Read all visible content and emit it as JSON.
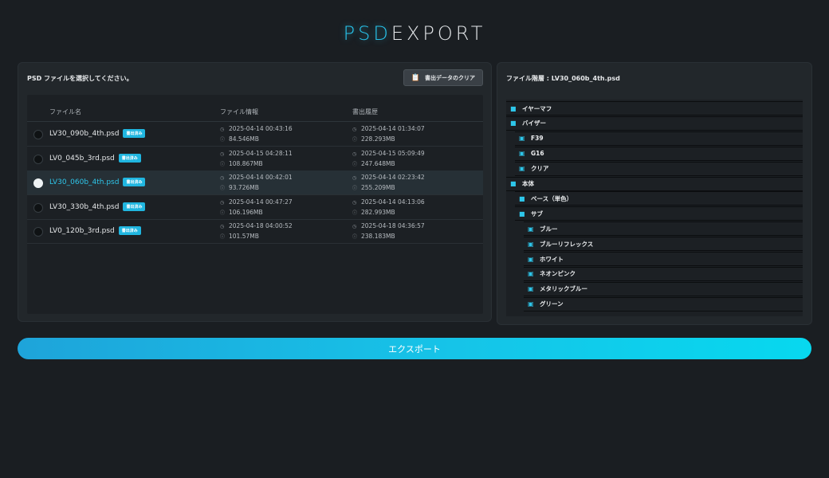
{
  "app": {
    "title_accent": "PSD",
    "title_rest": "EXPORT"
  },
  "left": {
    "prompt": "PSD ファイルを選択してください。",
    "clear_button": "書出データのクリア",
    "columns": [
      "ファイル名",
      "ファイル情報",
      "書出履歴"
    ],
    "files": [
      {
        "name": "LV30_090b_4th.psd",
        "badge": "書出済み",
        "modified": "2025-04-14 00:43:16",
        "size": "84.546MB",
        "export_time": "2025-04-14 01:34:07",
        "export_size": "228.293MB",
        "selected": false
      },
      {
        "name": "LV0_045b_3rd.psd",
        "badge": "書出済み",
        "modified": "2025-04-15 04:28:11",
        "size": "108.867MB",
        "export_time": "2025-04-15 05:09:49",
        "export_size": "247.648MB",
        "selected": false
      },
      {
        "name": "LV30_060b_4th.psd",
        "badge": "書出済み",
        "modified": "2025-04-14 00:42:01",
        "size": "93.726MB",
        "export_time": "2025-04-14 02:23:42",
        "export_size": "255.209MB",
        "selected": true
      },
      {
        "name": "LV30_330b_4th.psd",
        "badge": "書出済み",
        "modified": "2025-04-14 00:47:27",
        "size": "106.196MB",
        "export_time": "2025-04-14 04:13:06",
        "export_size": "282.993MB",
        "selected": false
      },
      {
        "name": "LV0_120b_3rd.psd",
        "badge": "書出済み",
        "modified": "2025-04-18 04:00:52",
        "size": "101.57MB",
        "export_time": "2025-04-18 04:36:57",
        "export_size": "238.183MB",
        "selected": false
      }
    ]
  },
  "right": {
    "header": "ファイル階層 : LV30_060b_4th.psd",
    "tree": [
      {
        "label": "イヤーマフ",
        "type": "folder",
        "depth": 0
      },
      {
        "label": "バイザー",
        "type": "folder",
        "depth": 0
      },
      {
        "label": "F39",
        "type": "layer",
        "depth": 1
      },
      {
        "label": "G16",
        "type": "layer",
        "depth": 1
      },
      {
        "label": "クリア",
        "type": "layer",
        "depth": 1
      },
      {
        "label": "本体",
        "type": "folder",
        "depth": 0
      },
      {
        "label": "ベース（単色）",
        "type": "folder",
        "depth": 1
      },
      {
        "label": "サブ",
        "type": "folder",
        "depth": 1
      },
      {
        "label": "ブルー",
        "type": "layer",
        "depth": 2
      },
      {
        "label": "ブルーリフレックス",
        "type": "layer",
        "depth": 2
      },
      {
        "label": "ホワイト",
        "type": "layer",
        "depth": 2
      },
      {
        "label": "ネオンピンク",
        "type": "layer",
        "depth": 2
      },
      {
        "label": "メタリックブルー",
        "type": "layer",
        "depth": 2
      },
      {
        "label": "グリーン",
        "type": "layer",
        "depth": 2
      }
    ]
  },
  "export_button": "エクスポート",
  "colors": {
    "accent": "#28c4ec",
    "background": "#1a1e22",
    "panel": "#22272b"
  }
}
